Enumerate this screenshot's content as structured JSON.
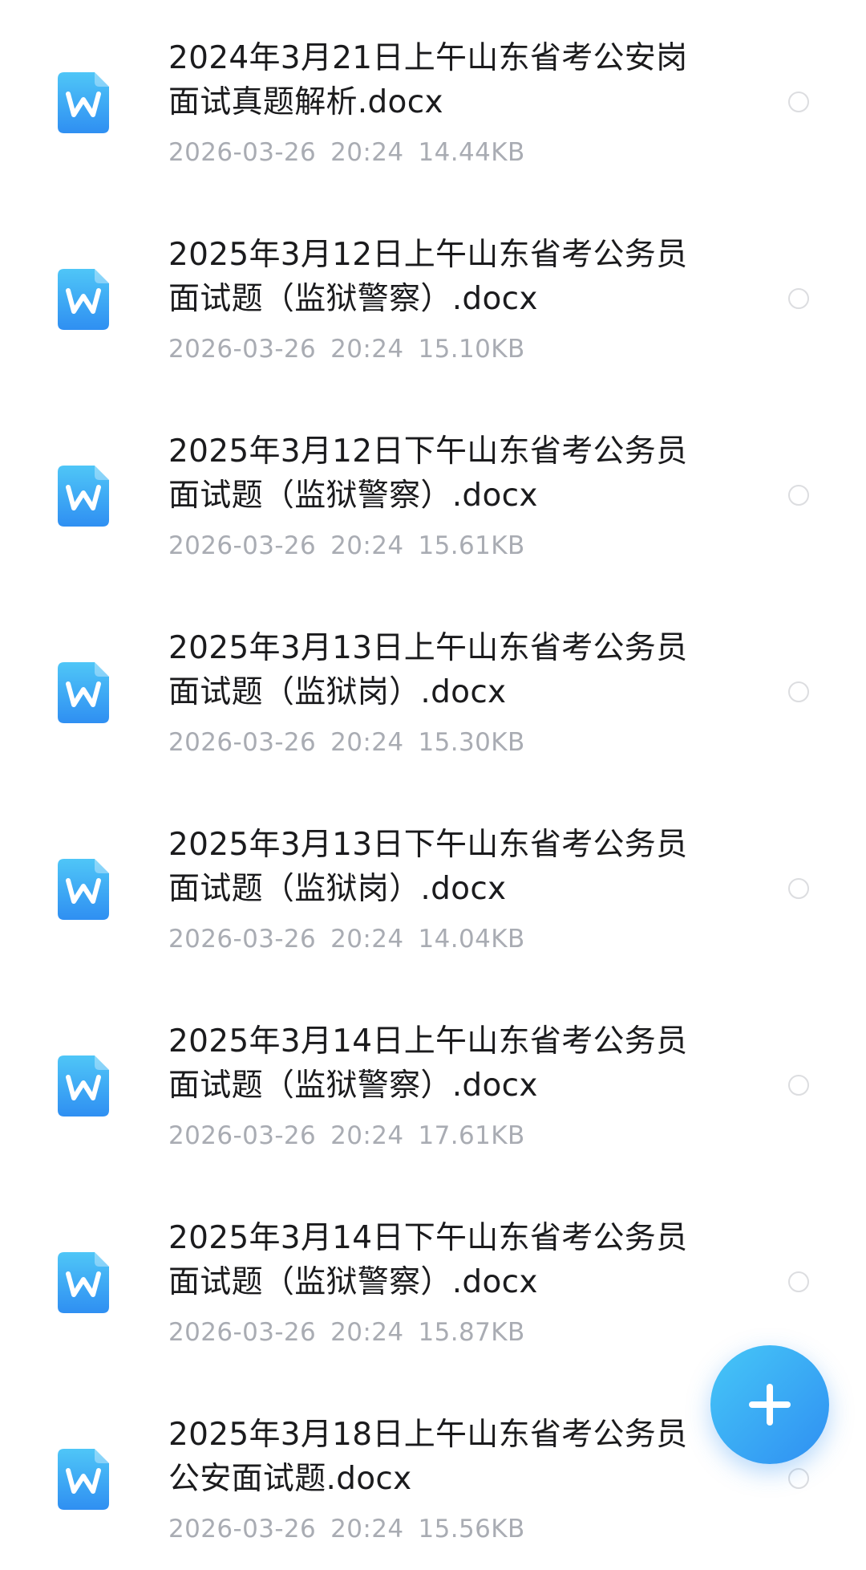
{
  "files": [
    {
      "name": "2024年3月21日上午山东省考公安岗面试真题解析.docx",
      "date": "2026-03-26",
      "time": "20:24",
      "size": "14.44KB"
    },
    {
      "name": "2025年3月12日上午山东省考公务员面试题（监狱警察）.docx",
      "date": "2026-03-26",
      "time": "20:24",
      "size": "15.10KB"
    },
    {
      "name": "2025年3月12日下午山东省考公务员面试题（监狱警察）.docx",
      "date": "2026-03-26",
      "time": "20:24",
      "size": "15.61KB"
    },
    {
      "name": "2025年3月13日上午山东省考公务员面试题（监狱岗）.docx",
      "date": "2026-03-26",
      "time": "20:24",
      "size": "15.30KB"
    },
    {
      "name": "2025年3月13日下午山东省考公务员面试题（监狱岗）.docx",
      "date": "2026-03-26",
      "time": "20:24",
      "size": "14.04KB"
    },
    {
      "name": "2025年3月14日上午山东省考公务员面试题（监狱警察）.docx",
      "date": "2026-03-26",
      "time": "20:24",
      "size": "17.61KB"
    },
    {
      "name": "2025年3月14日下午山东省考公务员面试题（监狱警察）.docx",
      "date": "2026-03-26",
      "time": "20:24",
      "size": "15.87KB"
    },
    {
      "name": "2025年3月18日上午山东省考公务员公安面试题.docx",
      "date": "2026-03-26",
      "time": "20:24",
      "size": "15.56KB"
    }
  ],
  "icons": {
    "file_icon": "word-doc-icon",
    "fab_icon": "plus-icon",
    "select_icon": "radio-unchecked-icon"
  },
  "colors": {
    "icon_gradient_top": "#4fc6f7",
    "icon_gradient_bottom": "#2f8ff2",
    "title_text": "#1b1b1d",
    "meta_text": "#a9acb3",
    "fab_start": "#46c7f7",
    "fab_end": "#2f8ff2"
  }
}
